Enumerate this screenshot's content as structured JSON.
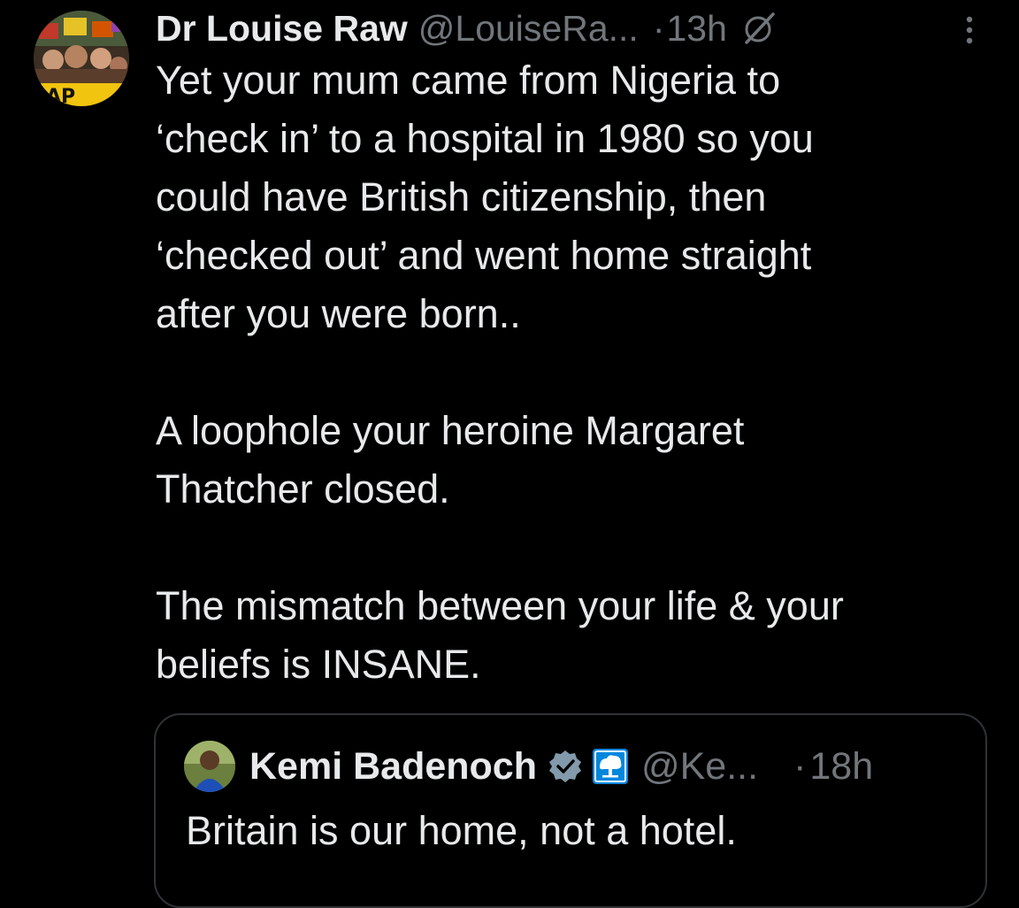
{
  "tweet": {
    "author": {
      "display_name": "Dr Louise Raw",
      "handle": "@LouiseRa...",
      "avatar_icon": "protest-photo-avatar"
    },
    "separator": "·",
    "timestamp": "13h",
    "grok_icon": "grok-icon",
    "more_icon": "more-dots-icon",
    "paragraphs": [
      "Yet your mum came from Nigeria to\n‘check in’ to a hospital in 1980 so you\ncould have British citizenship, then\n‘checked out’ and went home straight\nafter you were born..",
      "A loophole your heroine Margaret\nThatcher closed.",
      "The mismatch between your life & your\nbeliefs is INSANE."
    ]
  },
  "quote": {
    "author": {
      "display_name": "Kemi Badenoch",
      "handle": "@Ke...",
      "verified_icon": "verified-badge-icon",
      "affiliate_icon": "conservative-tree-icon"
    },
    "separator": "·",
    "timestamp": "18h",
    "text": "Britain is our home, not a hotel."
  },
  "colors": {
    "background": "#000000",
    "text_primary": "#e7e9ea",
    "text_secondary": "#71767b",
    "border": "#2f3336",
    "verified_gray": "#829aab",
    "affiliate_blue": "#0087dc"
  }
}
